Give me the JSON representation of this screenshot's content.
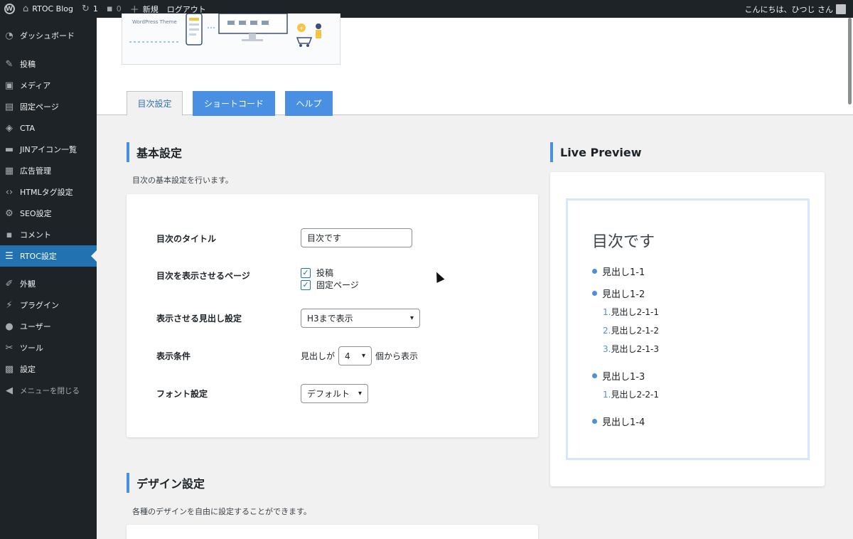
{
  "admin_bar": {
    "site_name": "RTOC Blog",
    "updates_count": "1",
    "comments_count": "0",
    "new_label": "新規",
    "logout_label": "ログアウト",
    "greeting": "こんにちは、ひつじ さん"
  },
  "sidebar": {
    "items": [
      {
        "label": "ダッシュボード",
        "icon": "dashboard-icon"
      },
      {
        "label": "投稿",
        "icon": "pin-icon"
      },
      {
        "label": "メディア",
        "icon": "media-icon"
      },
      {
        "label": "固定ページ",
        "icon": "page-icon"
      },
      {
        "label": "CTA",
        "icon": "diamond-icon"
      },
      {
        "label": "JINアイコン一覧",
        "icon": "folder-icon"
      },
      {
        "label": "広告管理",
        "icon": "ad-icon"
      },
      {
        "label": "HTMLタグ設定",
        "icon": "code-icon"
      },
      {
        "label": "SEO設定",
        "icon": "gear-icon"
      },
      {
        "label": "コメント",
        "icon": "comment-icon"
      },
      {
        "label": "RTOC設定",
        "icon": "list-icon"
      },
      {
        "label": "外観",
        "icon": "brush-icon"
      },
      {
        "label": "プラグイン",
        "icon": "plugin-icon"
      },
      {
        "label": "ユーザー",
        "icon": "user-icon"
      },
      {
        "label": "ツール",
        "icon": "wrench-icon"
      },
      {
        "label": "設定",
        "icon": "settings-icon"
      }
    ],
    "collapse_label": "メニューを閉じる"
  },
  "banner": {
    "caption": "WordPress Theme"
  },
  "tabs": [
    {
      "label": "目次設定"
    },
    {
      "label": "ショートコード"
    },
    {
      "label": "ヘルプ"
    }
  ],
  "basic": {
    "title": "基本設定",
    "desc": "目次の基本設定を行います。",
    "rows": {
      "title_label": "目次のタイトル",
      "title_value": "目次です",
      "pages_label": "目次を表示させるページ",
      "pages_options": [
        "投稿",
        "固定ページ"
      ],
      "heading_label": "表示させる見出し設定",
      "heading_value": "H3まで表示",
      "condition_label": "表示条件",
      "condition_prefix": "見出しが",
      "condition_value": "4",
      "condition_suffix": "個から表示",
      "font_label": "フォント設定",
      "font_value": "デフォルト"
    }
  },
  "design": {
    "title": "デザイン設定",
    "desc": "各種のデザインを自由に設定することができます。"
  },
  "preview": {
    "title": "Live Preview",
    "toc_title": "目次です",
    "h2": [
      "見出し1-1",
      "見出し1-2",
      "見出し1-3",
      "見出し1-4"
    ],
    "h3_group1": [
      {
        "num": "1.",
        "text": "見出し2-1-1"
      },
      {
        "num": "2.",
        "text": "見出し2-1-2"
      },
      {
        "num": "3.",
        "text": "見出し2-1-3"
      }
    ],
    "h3_group2": [
      {
        "num": "1.",
        "text": "見出し2-2-1"
      }
    ]
  },
  "colors": {
    "accent": "#4a90e2",
    "admin_bg": "#1d2327",
    "menu_active": "#2271b1"
  }
}
